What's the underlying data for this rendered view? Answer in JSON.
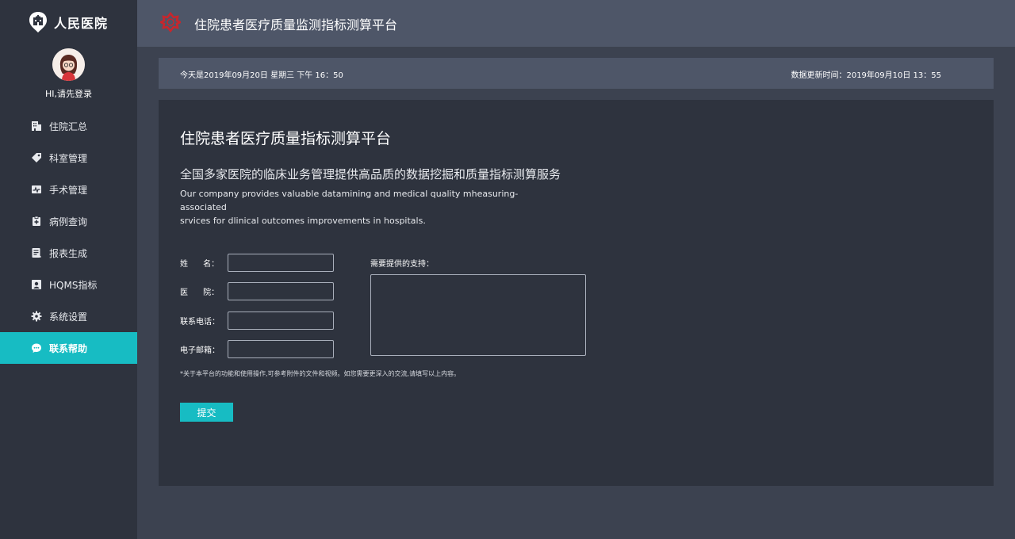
{
  "brand": {
    "name": "人民医院",
    "logo_icon": "hospital-logo-icon"
  },
  "user": {
    "greeting": "HI,请先登录",
    "avatar_icon": "avatar-icon"
  },
  "sidebar": {
    "items": [
      {
        "label": "住院汇总",
        "icon": "building-icon"
      },
      {
        "label": "科室管理",
        "icon": "tag-icon"
      },
      {
        "label": "手术管理",
        "icon": "pulse-icon"
      },
      {
        "label": "病例查询",
        "icon": "clipboard-icon"
      },
      {
        "label": "报表生成",
        "icon": "report-icon"
      },
      {
        "label": "HQMS指标",
        "icon": "monitor-icon"
      },
      {
        "label": "系统设置",
        "icon": "gear-icon"
      },
      {
        "label": "联系帮助",
        "icon": "chat-icon",
        "active": true
      }
    ]
  },
  "header": {
    "title": "住院患者医疗质量监测指标测算平台",
    "logo_icon": "red-cross-logo-icon"
  },
  "infobar": {
    "today": "今天是2019年09月20日  星期三  下午 16：50",
    "update": "数据更新时间：2019年09月10日  13：55"
  },
  "panel": {
    "title": "住院患者医疗质量指标测算平台",
    "subtitle": "全国多家医院的临床业务管理提供高品质的数据挖掘和质量指标测算服务",
    "desc_line1": "Our  company provides valuable datamining and medical quality mheasuring- associated",
    "desc_line2": "srvices for dlinical outcomes improvements in hospitals."
  },
  "form": {
    "name_label": "姓      名：",
    "hospital_label": "医      院：",
    "phone_label": "联系电话：",
    "email_label": "电子邮箱：",
    "support_label": "需要提供的支持：",
    "note": "*关于本平台的功能和使用操作,可参考附件的文件和视频。如您需要更深入的交流,请填写以上内容。",
    "submit_label": "提交",
    "name_value": "",
    "hospital_value": "",
    "phone_value": "",
    "email_value": "",
    "support_value": ""
  },
  "colors": {
    "accent": "#17bcc3",
    "sidebar_bg": "#2e333e",
    "header_bg": "#4e5668",
    "page_bg": "#3c4250",
    "logo_red": "#c8262c"
  }
}
